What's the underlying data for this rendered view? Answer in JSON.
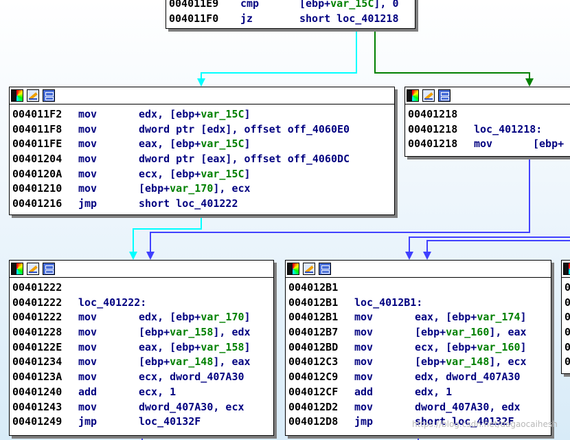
{
  "colors": {
    "edge_cyan": "#00ffff",
    "edge_green": "#008000",
    "edge_blue": "#4040ff",
    "addr_text": "#000000",
    "code_text": "#000080",
    "var_text": "#008000"
  },
  "icons": [
    "color-palette-icon",
    "edit-name-icon",
    "graph-view-icon"
  ],
  "blocks": {
    "top": {
      "rows": [
        {
          "addr": "004011E9",
          "mn": "cmp",
          "ops": "[ebp+var_15C], 0"
        },
        {
          "addr": "004011F0",
          "mn": "jz",
          "ops": "short loc_401218"
        }
      ]
    },
    "left_mid": {
      "rows": [
        {
          "addr": "004011F2",
          "mn": "mov",
          "ops": "edx, [ebp+var_15C]"
        },
        {
          "addr": "004011F8",
          "mn": "mov",
          "ops": "dword ptr [edx], offset off_4060E0"
        },
        {
          "addr": "004011FE",
          "mn": "mov",
          "ops": "eax, [ebp+var_15C]"
        },
        {
          "addr": "00401204",
          "mn": "mov",
          "ops": "dword ptr [eax], offset off_4060DC"
        },
        {
          "addr": "0040120A",
          "mn": "mov",
          "ops": "ecx, [ebp+var_15C]"
        },
        {
          "addr": "00401210",
          "mn": "mov",
          "ops": "[ebp+var_170], ecx"
        },
        {
          "addr": "00401216",
          "mn": "jmp",
          "ops": "short loc_401222"
        }
      ]
    },
    "right_mid": {
      "rows": [
        {
          "addr": "00401218",
          "mn": "",
          "ops": ""
        },
        {
          "addr": "00401218",
          "mn": "",
          "ops": "loc_401218:"
        },
        {
          "addr": "00401218",
          "mn": "mov",
          "ops": "[ebp+"
        }
      ]
    },
    "bottom_left": {
      "rows": [
        {
          "addr": "00401222",
          "mn": "",
          "ops": ""
        },
        {
          "addr": "00401222",
          "mn": "",
          "ops": "loc_401222:"
        },
        {
          "addr": "00401222",
          "mn": "mov",
          "ops": "edx, [ebp+var_170]"
        },
        {
          "addr": "00401228",
          "mn": "mov",
          "ops": "[ebp+var_158], edx"
        },
        {
          "addr": "0040122E",
          "mn": "mov",
          "ops": "eax, [ebp+var_158]"
        },
        {
          "addr": "00401234",
          "mn": "mov",
          "ops": "[ebp+var_148], eax"
        },
        {
          "addr": "0040123A",
          "mn": "mov",
          "ops": "ecx, dword_407A30"
        },
        {
          "addr": "00401240",
          "mn": "add",
          "ops": "ecx, 1"
        },
        {
          "addr": "00401243",
          "mn": "mov",
          "ops": "dword_407A30, ecx"
        },
        {
          "addr": "00401249",
          "mn": "jmp",
          "ops": "loc_40132F"
        }
      ]
    },
    "bottom_mid": {
      "rows": [
        {
          "addr": "004012B1",
          "mn": "",
          "ops": ""
        },
        {
          "addr": "004012B1",
          "mn": "",
          "ops": "loc_4012B1:"
        },
        {
          "addr": "004012B1",
          "mn": "mov",
          "ops": "eax, [ebp+var_174]"
        },
        {
          "addr": "004012B7",
          "mn": "mov",
          "ops": "[ebp+var_160], eax"
        },
        {
          "addr": "004012BD",
          "mn": "mov",
          "ops": "ecx, [ebp+var_160]"
        },
        {
          "addr": "004012C3",
          "mn": "mov",
          "ops": "[ebp+var_148], ecx"
        },
        {
          "addr": "004012C9",
          "mn": "mov",
          "ops": "edx, dword_407A30"
        },
        {
          "addr": "004012CF",
          "mn": "add",
          "ops": "edx, 1"
        },
        {
          "addr": "004012D2",
          "mn": "mov",
          "ops": "dword_407A30, edx"
        },
        {
          "addr": "004012D8",
          "mn": "jmp",
          "ops": "short loc_40132F"
        }
      ]
    },
    "bottom_right": {
      "rows": [
        {
          "addr": "0",
          "mn": "",
          "ops": ""
        },
        {
          "addr": "0",
          "mn": "",
          "ops": ""
        },
        {
          "addr": "0",
          "mn": "",
          "ops": ""
        },
        {
          "addr": "0",
          "mn": "",
          "ops": ""
        },
        {
          "addr": "0",
          "mn": "",
          "ops": ""
        },
        {
          "addr": "0",
          "mn": "",
          "ops": ""
        }
      ]
    }
  },
  "watermark": "https://blog.csdn.net/dagaocaihesh"
}
